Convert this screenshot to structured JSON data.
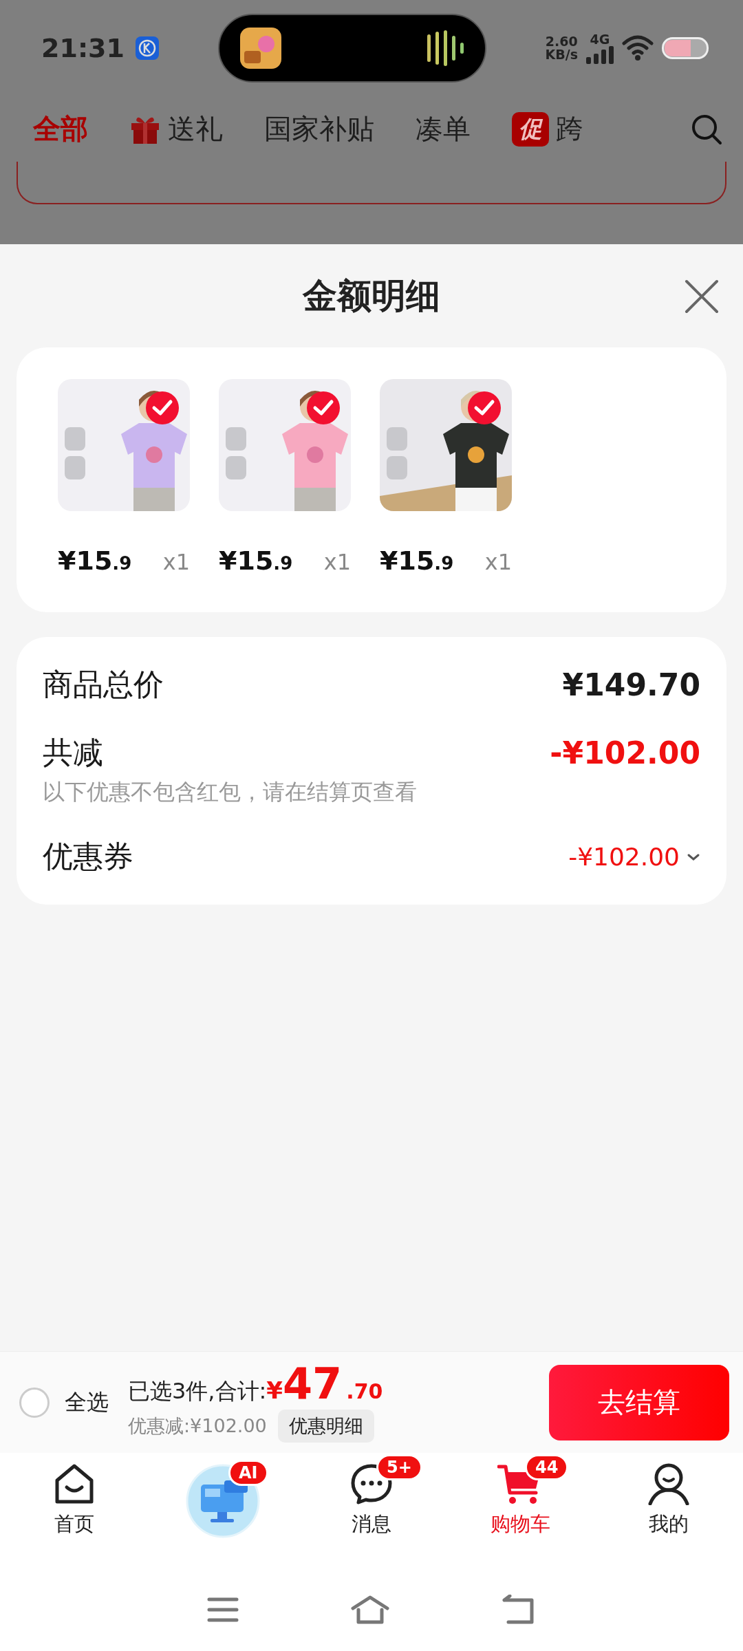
{
  "status_bar": {
    "time": "21:31",
    "net_speed": "2.60",
    "net_unit": "KB/s",
    "network": "4G"
  },
  "tabs": [
    {
      "label": "全部",
      "selected": true,
      "kind": "text"
    },
    {
      "label": "送礼",
      "selected": false,
      "kind": "gift"
    },
    {
      "label": "国家补贴",
      "selected": false,
      "kind": "text"
    },
    {
      "label": "凑单",
      "selected": false,
      "kind": "text"
    },
    {
      "label": "跨",
      "selected": false,
      "kind": "promo",
      "badge": "促"
    }
  ],
  "sheet": {
    "title": "金额明细"
  },
  "items": [
    {
      "kind": "picture",
      "checked": true,
      "price_main": "¥15",
      "price_decimal": ".9",
      "quantity": "x1"
    },
    {
      "kind": "picture",
      "checked": true,
      "price_main": "¥15",
      "price_decimal": ".9",
      "quantity": "x1"
    },
    {
      "kind": "picture",
      "checked": true,
      "price_main": "¥15",
      "price_decimal": ".9",
      "quantity": "x1"
    }
  ],
  "summary": {
    "total_label": "商品总价",
    "total_value": "¥149.70",
    "discount_label": "共减",
    "discount_value": "-¥102.00",
    "discount_note": "以下优惠不包含红包，请在结算页查看",
    "coupon_label": "优惠券",
    "coupon_value": "-¥102.00"
  },
  "checkout": {
    "select_all": {
      "label": "全选",
      "checked": false
    },
    "selected_text": "已选3件,合计:",
    "currency": "¥",
    "amount_int": "47",
    "amount_dec": ".70",
    "saving": "优惠减:¥102.00",
    "detail_button": "优惠明细",
    "submit": "去结算"
  },
  "nav": [
    {
      "kind": "home",
      "label": "首页",
      "selected": false
    },
    {
      "kind": "ai",
      "badge": "AI",
      "selected": false
    },
    {
      "kind": "message",
      "label": "消息",
      "badge": "5+",
      "selected": false
    },
    {
      "kind": "cart",
      "label": "购物车",
      "badge": "44",
      "selected": true
    },
    {
      "kind": "profile",
      "label": "我的",
      "selected": false
    }
  ]
}
